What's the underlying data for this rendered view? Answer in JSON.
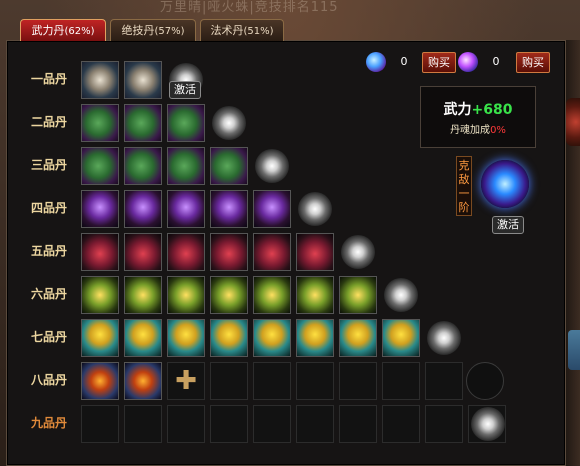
{
  "background_title": "万里晴|哑火蛛|竞技排名115",
  "tabs": [
    {
      "label": "武力丹",
      "pct": "(62%)",
      "active": true
    },
    {
      "label": "绝技丹",
      "pct": "(57%)",
      "active": false
    },
    {
      "label": "法术丹",
      "pct": "(51%)",
      "active": false
    }
  ],
  "currency": [
    {
      "icon": "blue-orb-icon",
      "count": "0",
      "buy_label": "购买"
    },
    {
      "icon": "purple-orb-icon",
      "count": "0",
      "buy_label": "购买"
    }
  ],
  "stats": {
    "name": "武力",
    "value": "+680",
    "bonus_label": "丹魂加成",
    "bonus_pct": "0%"
  },
  "kedi": {
    "label": "克敌一阶",
    "activate_label": "激活"
  },
  "grade_activate_label": "激活",
  "grades": [
    {
      "label": "一品丹",
      "filled": 2,
      "item": "white-pill-icon"
    },
    {
      "label": "二品丹",
      "filled": 3,
      "item": "green-pill-icon"
    },
    {
      "label": "三品丹",
      "filled": 4,
      "item": "green-pill-icon"
    },
    {
      "label": "四品丹",
      "filled": 5,
      "item": "purple-pill-icon"
    },
    {
      "label": "五品丹",
      "filled": 6,
      "item": "red-pill-icon"
    },
    {
      "label": "六品丹",
      "filled": 7,
      "item": "gold-box-icon"
    },
    {
      "label": "七品丹",
      "filled": 8,
      "item": "gold-pot-icon"
    },
    {
      "label": "八品丹",
      "filled": 2,
      "item": "fire-scroll-icon"
    },
    {
      "label": "九品丹",
      "filled": 0,
      "item": "none"
    }
  ]
}
